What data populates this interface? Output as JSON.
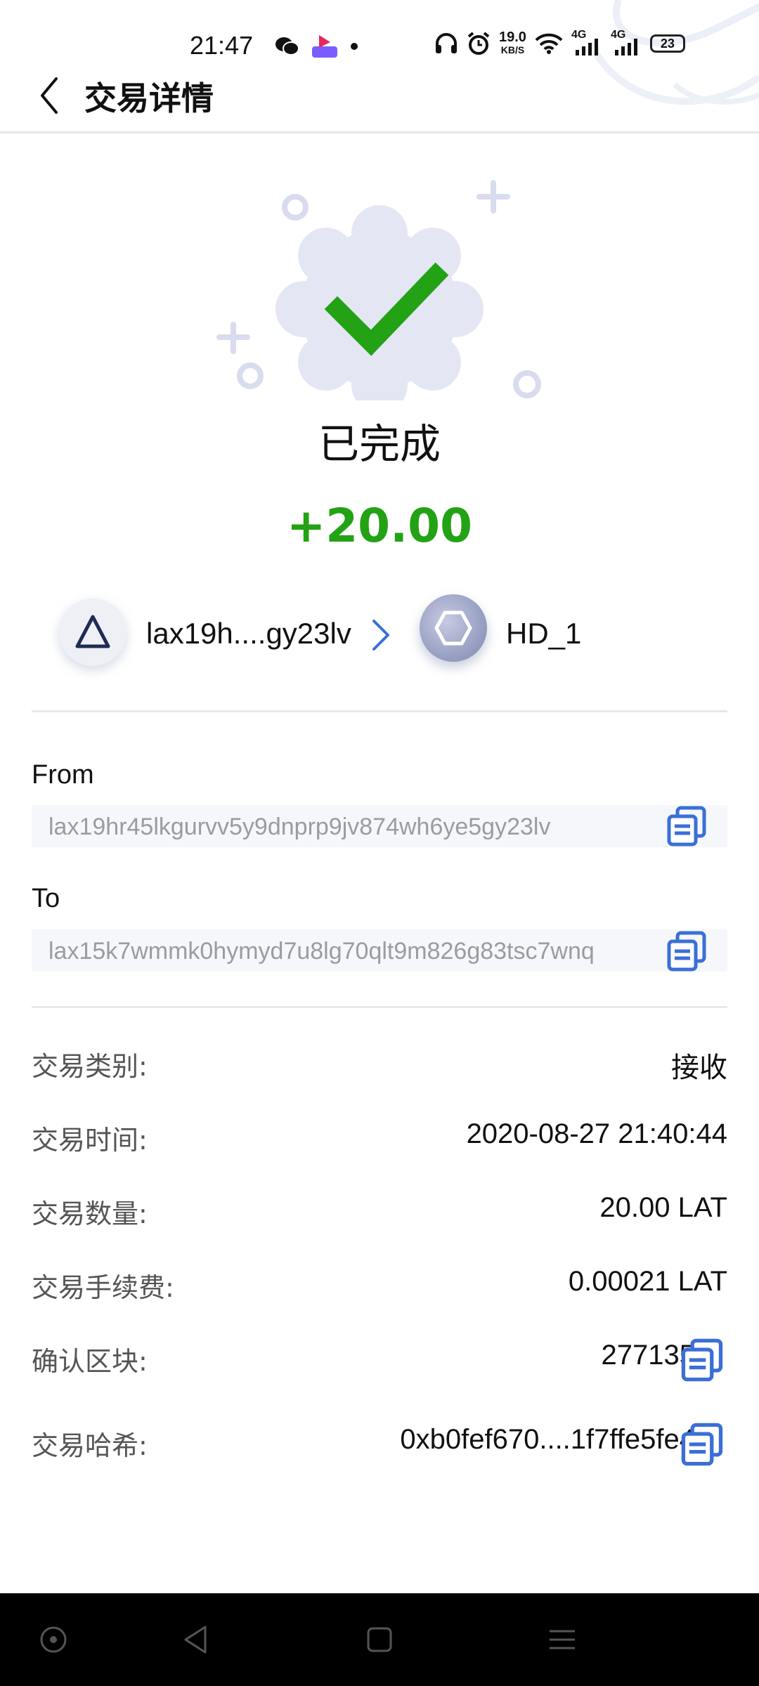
{
  "status_bar": {
    "time": "21:47",
    "speed_value": "19.0",
    "speed_unit": "KB/S",
    "network_1": "4G",
    "network_2": "4G",
    "battery": "23",
    "icons": [
      "wechat-icon",
      "app-notification-icon",
      "dot-icon",
      "headset-icon",
      "alarm-icon",
      "wifi-icon",
      "signal-icon",
      "signal-icon",
      "battery-icon"
    ]
  },
  "header": {
    "title": "交易详情",
    "back_icon": "chevron-left-icon"
  },
  "transaction": {
    "status": "已完成",
    "amount": "+20.00",
    "status_icon": "check-badge-icon"
  },
  "transfer": {
    "from_name": "lax19h....gy23lv",
    "to_name": "HD_1",
    "arrow_icon": "chevron-right-icon"
  },
  "from_block": {
    "label": "From",
    "address": "lax19hr45lkgurvv5y9dnprp9jv874wh6ye5gy23lv"
  },
  "to_block": {
    "label": "To",
    "address": "lax15k7wmmk0hymyd7u8lg70qlt9m826g83tsc7wnq"
  },
  "details": [
    {
      "label": "交易类别:",
      "value": "接收"
    },
    {
      "label": "交易时间:",
      "value": "2020-08-27 21:40:44"
    },
    {
      "label": "交易数量:",
      "value": "20.00 LAT"
    },
    {
      "label": "交易手续费:",
      "value": "0.00021 LAT"
    },
    {
      "label": "确认区块:",
      "value": "277135"
    },
    {
      "label": "交易哈希:",
      "value": "0xb0fef670....1f7ffe5fe4"
    }
  ],
  "colors": {
    "success_green": "#22a214",
    "accent_blue": "#3a6fd8",
    "badge_bg": "#e4e7f3",
    "address_text": "#9a9ca3"
  },
  "nav_bar": {
    "icons": [
      "home-circle-icon",
      "back-triangle-icon",
      "recents-square-icon",
      "menu-lines-icon"
    ]
  }
}
